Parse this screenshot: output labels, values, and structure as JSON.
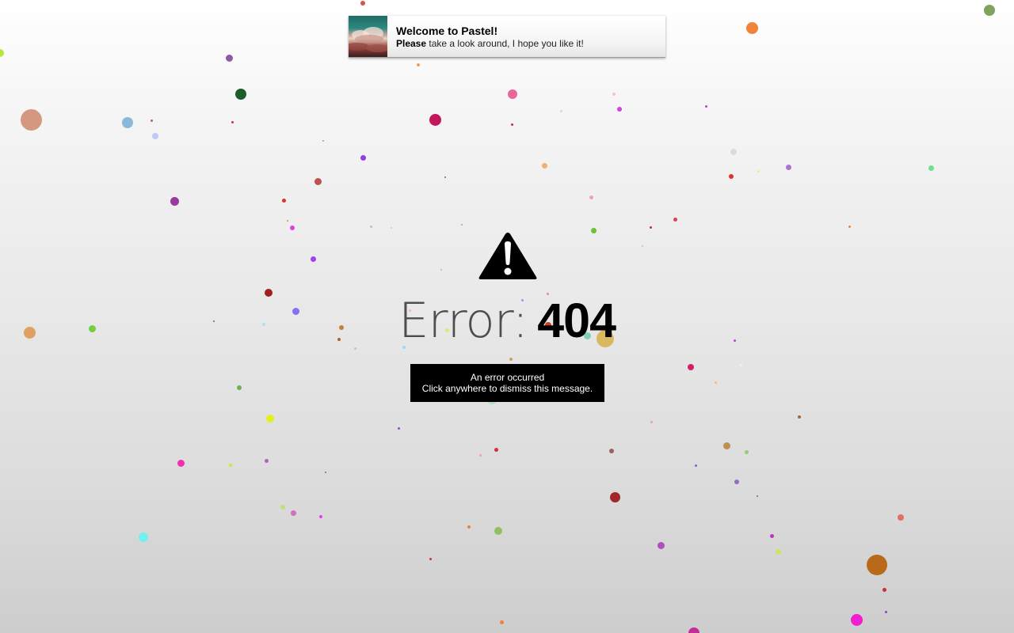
{
  "notification": {
    "title": "Welcome to Pastel!",
    "body_bold": "Please",
    "body_text": " take a look around, I hope you like it!"
  },
  "error": {
    "label": "Error:",
    "code": "404",
    "icon": "warning-icon"
  },
  "message": {
    "line1": "An error occurred",
    "line2": "Click anywhere to dismiss this message."
  },
  "colors": {
    "message_bg": "#000000",
    "message_text": "#ffffff",
    "icon": "#000000"
  }
}
